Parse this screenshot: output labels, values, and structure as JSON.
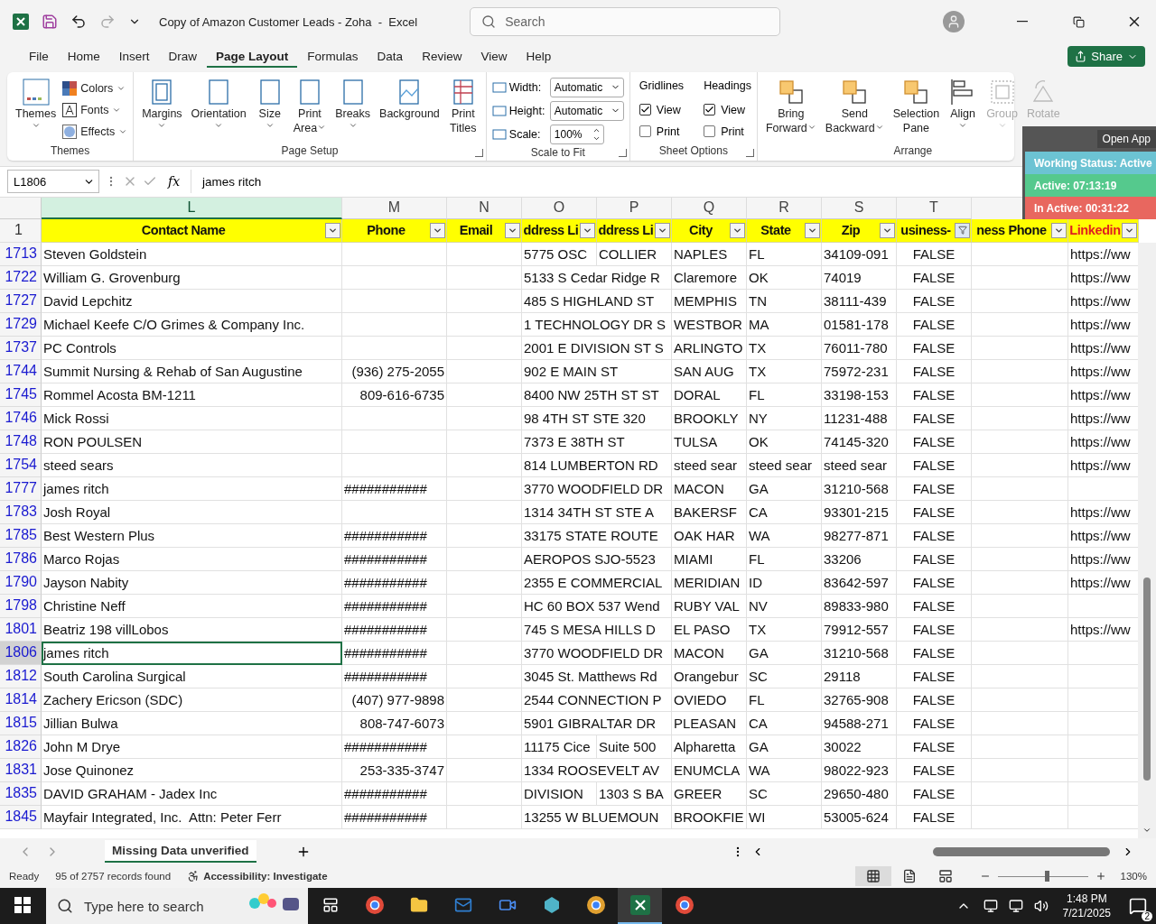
{
  "title_bar": {
    "title": "Copy of Amazon Customer Leads - Zoha  -  Excel",
    "search_placeholder": "Search"
  },
  "menu_tabs": [
    {
      "label": "File",
      "selected": false
    },
    {
      "label": "Home",
      "selected": false
    },
    {
      "label": "Insert",
      "selected": false
    },
    {
      "label": "Draw",
      "selected": false
    },
    {
      "label": "Page Layout",
      "selected": true
    },
    {
      "label": "Formulas",
      "selected": false
    },
    {
      "label": "Data",
      "selected": false
    },
    {
      "label": "Review",
      "selected": false
    },
    {
      "label": "View",
      "selected": false
    },
    {
      "label": "Help",
      "selected": false
    }
  ],
  "share_button": "Share",
  "ribbon": {
    "themes": {
      "label": "Themes",
      "big": {
        "lines": [
          "Themes"
        ],
        "dropdown": true
      },
      "small": [
        {
          "label": "Colors"
        },
        {
          "label": "Fonts"
        },
        {
          "label": "Effects"
        }
      ]
    },
    "page_setup": {
      "label": "Page Setup",
      "buttons": [
        {
          "lines": [
            "Margins"
          ],
          "dropdown": true
        },
        {
          "lines": [
            "Orientation"
          ],
          "dropdown": true
        },
        {
          "lines": [
            "Size"
          ],
          "dropdown": true
        },
        {
          "lines": [
            "Print",
            "Area"
          ],
          "dropdown": true
        },
        {
          "lines": [
            "Breaks"
          ],
          "dropdown": true
        },
        {
          "lines": [
            "Background"
          ],
          "dropdown": false
        },
        {
          "lines": [
            "Print",
            "Titles"
          ],
          "dropdown": false
        }
      ]
    },
    "scale_to_fit": {
      "label": "Scale to Fit",
      "fields": [
        {
          "label": "Width:",
          "value": "Automatic",
          "kind": "dropdown"
        },
        {
          "label": "Height:",
          "value": "Automatic",
          "kind": "dropdown"
        },
        {
          "label": "Scale:",
          "value": "100%",
          "kind": "spinner"
        }
      ]
    },
    "sheet_options": {
      "label": "Sheet Options",
      "columns": [
        {
          "heading": "Gridlines",
          "options": [
            {
              "label": "View",
              "checked": true
            },
            {
              "label": "Print",
              "checked": false
            }
          ]
        },
        {
          "heading": "Headings",
          "options": [
            {
              "label": "View",
              "checked": true
            },
            {
              "label": "Print",
              "checked": false
            }
          ]
        }
      ]
    },
    "arrange": {
      "label": "Arrange",
      "buttons": [
        {
          "lines": [
            "Bring",
            "Forward"
          ],
          "dropdown": true,
          "disabled": false
        },
        {
          "lines": [
            "Send",
            "Backward"
          ],
          "dropdown": true,
          "disabled": false
        },
        {
          "lines": [
            "Selection",
            "Pane"
          ],
          "dropdown": false,
          "disabled": false
        },
        {
          "lines": [
            "Align"
          ],
          "dropdown": true,
          "disabled": false
        },
        {
          "lines": [
            "Group"
          ],
          "dropdown": true,
          "disabled": true
        },
        {
          "lines": [
            "Rotate"
          ],
          "dropdown": false,
          "disabled": true
        }
      ]
    }
  },
  "formula_bar": {
    "name_box": "L1806",
    "function_label": "fx",
    "value": "james ritch"
  },
  "sheet": {
    "column_letters": [
      "L",
      "M",
      "N",
      "O",
      "P",
      "Q",
      "R",
      "S",
      "T"
    ],
    "header_row_number": "1",
    "headers": [
      {
        "label": "Contact Name",
        "filtered": false
      },
      {
        "label": "Phone",
        "filtered": false
      },
      {
        "label": "Email",
        "filtered": false
      },
      {
        "label": "ddress Li",
        "filtered": false
      },
      {
        "label": "ddress Li",
        "filtered": false
      },
      {
        "label": "City",
        "filtered": false
      },
      {
        "label": "State",
        "filtered": false
      },
      {
        "label": "Zip",
        "filtered": false
      },
      {
        "label": "usiness-",
        "filtered": true
      },
      {
        "label": "ness Phone",
        "filtered": false
      },
      {
        "label": "Linkedin",
        "filtered": false
      }
    ],
    "rows": [
      {
        "number": "1713",
        "selected": false,
        "name": "Steven Goldstein",
        "address_1": "5775 OSC",
        "address_2": "COLLIER",
        "city": "NAPLES",
        "state": "FL",
        "zip": "34109-091",
        "business": "FALSE",
        "linkedin": "https://ww"
      },
      {
        "number": "1722",
        "selected": false,
        "name": "William G. Grovenburg",
        "address_1": "5133 S Cedar Ridge R",
        "city": "Claremore",
        "state": "OK",
        "zip": "74019",
        "business": "FALSE",
        "linkedin": "https://ww"
      },
      {
        "number": "1727",
        "selected": false,
        "name": "David Lepchitz",
        "address_1": "485 S HIGHLAND ST",
        "city": "MEMPHIS",
        "state": "TN",
        "zip": "38111-439",
        "business": "FALSE",
        "linkedin": "https://ww"
      },
      {
        "number": "1729",
        "selected": false,
        "name": "Michael Keefe C/O Grimes & Company Inc.",
        "address_1": "1 TECHNOLOGY DR S",
        "city": "WESTBOR",
        "state": "MA",
        "zip": "01581-178",
        "business": "FALSE",
        "linkedin": "https://ww"
      },
      {
        "number": "1737",
        "selected": false,
        "name": "PC Controls",
        "address_1": "2001 E DIVISION ST S",
        "city": "ARLINGTO",
        "state": "TX",
        "zip": "76011-780",
        "business": "FALSE",
        "linkedin": "https://ww"
      },
      {
        "number": "1744",
        "selected": false,
        "name": "Summit Nursing & Rehab of San Augustine",
        "phone": "(936) 275-2055",
        "address_1": "902 E MAIN ST",
        "city": "SAN AUG",
        "state": "TX",
        "zip": "75972-231",
        "business": "FALSE",
        "linkedin": "https://ww"
      },
      {
        "number": "1745",
        "selected": false,
        "name": "Rommel Acosta BM-1211",
        "phone": "809-616-6735",
        "address_1": "8400 NW 25TH ST ST",
        "city": "DORAL",
        "state": "FL",
        "zip": "33198-153",
        "business": "FALSE",
        "linkedin": "https://ww"
      },
      {
        "number": "1746",
        "selected": false,
        "name": "Mick Rossi",
        "address_1": "98 4TH ST STE 320",
        "city": "BROOKLY",
        "state": "NY",
        "zip": "11231-488",
        "business": "FALSE",
        "linkedin": "https://ww"
      },
      {
        "number": "1748",
        "selected": false,
        "name": "RON POULSEN",
        "address_1": "7373 E 38TH ST",
        "city": "TULSA",
        "state": "OK",
        "zip": "74145-320",
        "business": "FALSE",
        "linkedin": "https://ww"
      },
      {
        "number": "1754",
        "selected": false,
        "name": "steed sears",
        "address_1": "814 LUMBERTON RD",
        "city": "steed sear",
        "state": "steed sear",
        "zip": "steed sear",
        "business": "FALSE",
        "linkedin": "https://ww"
      },
      {
        "number": "1777",
        "selected": false,
        "name": "james ritch",
        "phone": "###########",
        "address_1": "3770 WOODFIELD DR",
        "city": "MACON",
        "state": "GA",
        "zip": "31210-568",
        "business": "FALSE"
      },
      {
        "number": "1783",
        "selected": false,
        "name": "Josh Royal",
        "address_1": "1314 34TH ST STE A",
        "city": "BAKERSF",
        "state": "CA",
        "zip": "93301-215",
        "business": "FALSE",
        "linkedin": "https://ww"
      },
      {
        "number": "1785",
        "selected": false,
        "name": "Best Western Plus",
        "phone": "###########",
        "address_1": "33175 STATE ROUTE",
        "city": "OAK HAR",
        "state": "WA",
        "zip": "98277-871",
        "business": "FALSE",
        "linkedin": "https://ww"
      },
      {
        "number": "1786",
        "selected": false,
        "name": "Marco Rojas",
        "phone": "###########",
        "address_1": "AEROPOS SJO-5523",
        "city": "MIAMI",
        "state": "FL",
        "zip": "33206",
        "business": "FALSE",
        "linkedin": "https://ww"
      },
      {
        "number": "1790",
        "selected": false,
        "name": "Jayson Nabity",
        "phone": "###########",
        "address_1": "2355 E COMMERCIAL",
        "city": "MERIDIAN",
        "state": "ID",
        "zip": "83642-597",
        "business": "FALSE",
        "linkedin": "https://ww"
      },
      {
        "number": "1798",
        "selected": false,
        "name": "Christine Neff",
        "phone": "###########",
        "address_1": "HC 60 BOX 537 Wend",
        "city": "RUBY VAL",
        "state": "NV",
        "zip": "89833-980",
        "business": "FALSE"
      },
      {
        "number": "1801",
        "selected": false,
        "name": "Beatriz 198 villLobos",
        "phone": "###########",
        "address_1": "745 S MESA HILLS D",
        "city": "EL PASO",
        "state": "TX",
        "zip": "79912-557",
        "business": "FALSE",
        "linkedin": "https://ww"
      },
      {
        "number": "1806",
        "selected": true,
        "name": "james ritch",
        "phone": "###########",
        "address_1": "3770 WOODFIELD DR",
        "city": "MACON",
        "state": "GA",
        "zip": "31210-568",
        "business": "FALSE"
      },
      {
        "number": "1812",
        "selected": false,
        "name": "South Carolina Surgical",
        "phone": "###########",
        "address_1": "3045 St. Matthews Rd",
        "city": "Orangebur",
        "state": "SC",
        "zip": "29118",
        "business": "FALSE"
      },
      {
        "number": "1814",
        "selected": false,
        "name": "Zachery Ericson (SDC)",
        "phone": "(407) 977-9898",
        "address_1": "2544 CONNECTION P",
        "city": "OVIEDO",
        "state": "FL",
        "zip": "32765-908",
        "business": "FALSE"
      },
      {
        "number": "1815",
        "selected": false,
        "name": "Jillian Bulwa",
        "phone": "808-747-6073",
        "address_1": "5901 GIBRALTAR DR",
        "city": "PLEASAN",
        "state": "CA",
        "zip": "94588-271",
        "business": "FALSE"
      },
      {
        "number": "1826",
        "selected": false,
        "name": "John M Drye",
        "phone": "###########",
        "address_1": "11175 Cice",
        "address_2": "Suite 500",
        "city": "Alpharetta",
        "state": "GA",
        "zip": "30022",
        "business": "FALSE"
      },
      {
        "number": "1831",
        "selected": false,
        "name": "Jose Quinonez",
        "phone": "253-335-3747",
        "address_1": "1334 ROOSEVELT AV",
        "city": "ENUMCLA",
        "state": "WA",
        "zip": "98022-923",
        "business": "FALSE"
      },
      {
        "number": "1835",
        "selected": false,
        "name": "DAVID GRAHAM - Jadex Inc",
        "phone": "###########",
        "address_1": "DIVISION",
        "address_2": "1303 S BA",
        "city": "GREER",
        "state": "SC",
        "zip": "29650-480",
        "business": "FALSE"
      },
      {
        "number": "1845",
        "selected": false,
        "name": "Mayfair Integrated, Inc.  Attn: Peter Ferr",
        "phone": "###########",
        "address_1": "13255 W BLUEMOUN",
        "city": "BROOKFIE",
        "state": "WI",
        "zip": "53005-624",
        "business": "FALSE"
      }
    ]
  },
  "timer_overlay": {
    "open_app_button": "Open App",
    "statuses": [
      {
        "text": "Working Status: Active",
        "color": "#6cc3d3"
      },
      {
        "text": "Active: 07:13:19",
        "color": "#55c98d"
      },
      {
        "text": "In Active: 00:31:22",
        "color": "#e8675f"
      }
    ]
  },
  "sheet_tabs": [
    {
      "label": "Missing Data unverified",
      "selected": true
    }
  ],
  "status_bar": {
    "mode": "Ready",
    "records": "95 of 2757 records found",
    "accessibility": "Accessibility: Investigate",
    "views": [
      {
        "selected": true
      },
      {
        "selected": false
      },
      {
        "selected": false
      }
    ],
    "zoom": {
      "level": 0.55,
      "label": "130%"
    }
  },
  "taskbar": {
    "search_placeholder": "Type here to search",
    "time": "1:48 PM",
    "date": "7/21/2025",
    "notifications": "2"
  }
}
